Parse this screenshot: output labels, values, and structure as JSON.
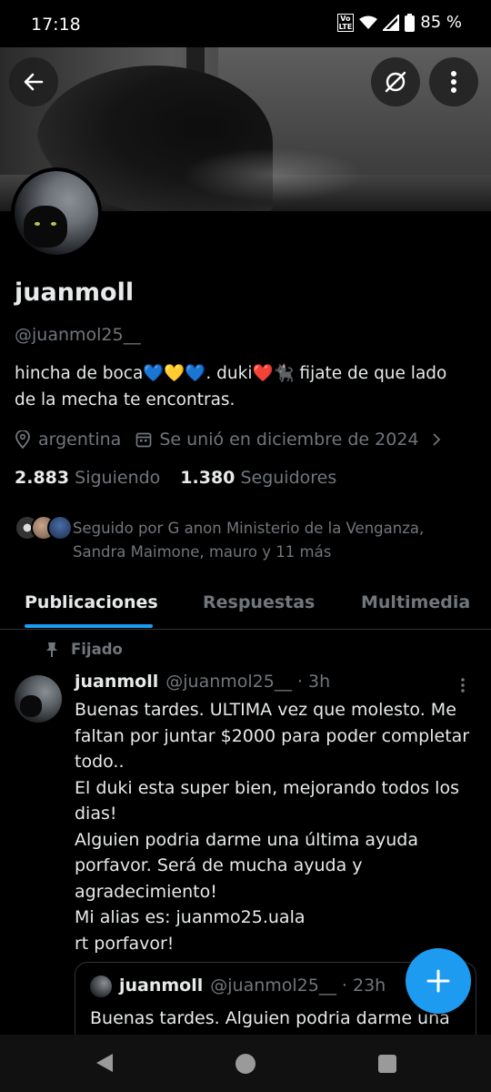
{
  "status_bar": {
    "time": "17:18",
    "volte": "Vo\nLTE",
    "battery": "85 %"
  },
  "header": {
    "back_icon": "arrow-left-icon",
    "hide_icon": "eye-slash-icon",
    "more_icon": "more-vertical-icon"
  },
  "profile": {
    "name": "juanmoll",
    "handle": "@juanmol25__",
    "bio_line1": "hincha de boca💙💛💙. duki❤️🐈‍⬛ fijate de que lado",
    "bio_line2": "de la mecha te encontras.",
    "location": "argentina",
    "joined": "Se unió en diciembre de 2024",
    "following_count": "2.883",
    "following_label": "Siguiendo",
    "followers_count": "1.380",
    "followers_label": "Seguidores",
    "followed_by_line1": "Seguido por G anon Ministerio de la Venganza,",
    "followed_by_line2": "Sandra Maimone, mauro y 11 más"
  },
  "tabs": [
    {
      "label": "Publicaciones",
      "active": true
    },
    {
      "label": "Respuestas",
      "active": false
    },
    {
      "label": "Multimedia",
      "active": false
    }
  ],
  "pinned_label": "Fijado",
  "tweet": {
    "name": "juanmoll",
    "meta": "@juanmol25__ · 3h",
    "lines": [
      "Buenas tardes. ULTIMA vez que molesto. Me",
      "faltan por juntar $2000 para poder completar",
      "todo..",
      "El duki esta super bien, mejorando todos los",
      "dias!",
      "Alguien podria darme una última ayuda",
      "porfavor. Será de mucha ayuda y",
      "agradecimiento!",
      "Mi alias es: juanmo25.uala",
      "rt porfavor!"
    ],
    "quote": {
      "name": "juanmoll",
      "meta": "@juanmol25__ · 23h",
      "text": "Buenas tardes. Alguien podria darme una"
    }
  },
  "colors": {
    "accent": "#1d9bf0",
    "muted": "#71767b",
    "text": "#e7e9ea",
    "background": "#000000"
  }
}
